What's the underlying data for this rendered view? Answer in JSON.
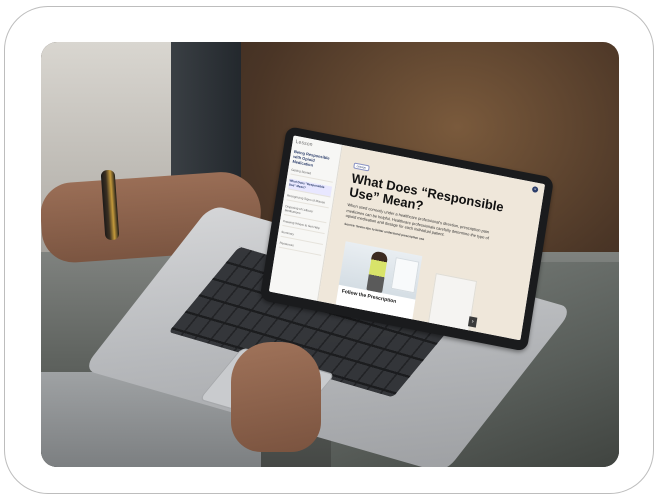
{
  "screen": {
    "logo": "Lesson",
    "sidebar": {
      "course_title": "Being Responsible with Opioid Medication",
      "items": [
        "Getting Started",
        "What Does \"Responsible Use\" Mean?",
        "Recognizing Signs of Misuse",
        "Disposing of Leftover Medications",
        "Knowing Where to Get Help",
        "Summary",
        "Resources"
      ],
      "active_index": 1
    },
    "main": {
      "tag": "Lesson",
      "heading": "What Does “Responsible Use” Mean?",
      "body": "When used correctly under a healthcare professional's direction, prescription pain medicines can be helpful. Healthcare professionals carefully determine the type of opioid medication and dosage for each individual patient.",
      "source": "Source: Seven tips to better understand prescription use",
      "card_caption": "Follow the Prescription",
      "next_symbol": "›",
      "close_symbol": "×"
    }
  }
}
